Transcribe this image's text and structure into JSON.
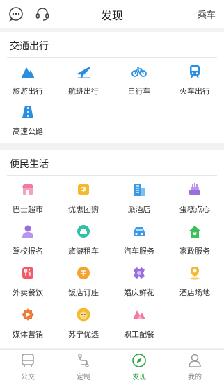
{
  "header": {
    "title": "发现",
    "right_label": "乘车"
  },
  "transport": {
    "title": "交通出行",
    "items": [
      {
        "label": "旅游出行",
        "icon": "mountain-icon",
        "color": "#2a8fe0"
      },
      {
        "label": "航班出行",
        "icon": "plane-icon",
        "color": "#2a8fe0"
      },
      {
        "label": "自行车",
        "icon": "bicycle-icon",
        "color": "#2a8fe0"
      },
      {
        "label": "火车出行",
        "icon": "train-icon",
        "color": "#2a8fe0"
      },
      {
        "label": "高速公路",
        "icon": "highway-icon",
        "color": "#2a8fe0"
      }
    ]
  },
  "life": {
    "title": "便民生活",
    "items": [
      {
        "label": "巴士超市",
        "icon": "shop-icon",
        "color": "#f27aa0"
      },
      {
        "label": "优惠团购",
        "icon": "coupon-icon",
        "color": "#f5b82e"
      },
      {
        "label": "派酒店",
        "icon": "hotel-building-icon",
        "color": "#3a9ae8"
      },
      {
        "label": "蛋糕点心",
        "icon": "cake-icon",
        "color": "#9b6ee0"
      },
      {
        "label": "驾校报名",
        "icon": "driver-icon",
        "color": "#9b6ee0"
      },
      {
        "label": "旅游租车",
        "icon": "car-rental-icon",
        "color": "#2fc0a8"
      },
      {
        "label": "汽车服务",
        "icon": "car-service-icon",
        "color": "#3a9ae8"
      },
      {
        "label": "家政服务",
        "icon": "house-icon",
        "color": "#3cbf5a"
      },
      {
        "label": "外卖餐饮",
        "icon": "food-icon",
        "color": "#f25a6a"
      },
      {
        "label": "饭店订座",
        "icon": "restaurant-icon",
        "color": "#f5a22e"
      },
      {
        "label": "婚庆鲜花",
        "icon": "flower-icon",
        "color": "#9b6ee0"
      },
      {
        "label": "酒店场地",
        "icon": "location-icon",
        "color": "#f5b82e"
      },
      {
        "label": "媒体营销",
        "icon": "media-icon",
        "color": "#f07a3a"
      },
      {
        "label": "苏宁优选",
        "icon": "lion-icon",
        "color": "#f5b82e"
      },
      {
        "label": "职工配餐",
        "icon": "meal-icon",
        "color": "#f27aa0"
      }
    ]
  },
  "tabs": [
    {
      "label": "公交",
      "icon": "bus-icon",
      "active": false
    },
    {
      "label": "定制",
      "icon": "route-icon",
      "active": false
    },
    {
      "label": "发现",
      "icon": "compass-icon",
      "active": true
    },
    {
      "label": "我的",
      "icon": "profile-icon",
      "active": false
    }
  ],
  "colors": {
    "accent": "#2ca34a",
    "icon_blue": "#2a8fe0"
  }
}
